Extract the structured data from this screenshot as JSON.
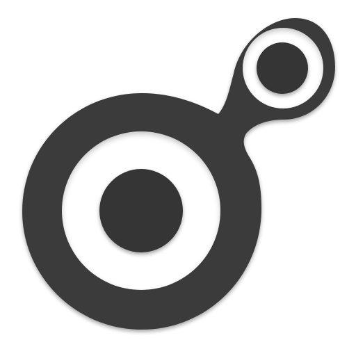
{
  "icon": {
    "name": "connected-rings-logo-icon",
    "colors": {
      "background": "#ffffff",
      "shape": "#3a3a3a",
      "inner": "#333333",
      "shadow": "#000000"
    }
  }
}
